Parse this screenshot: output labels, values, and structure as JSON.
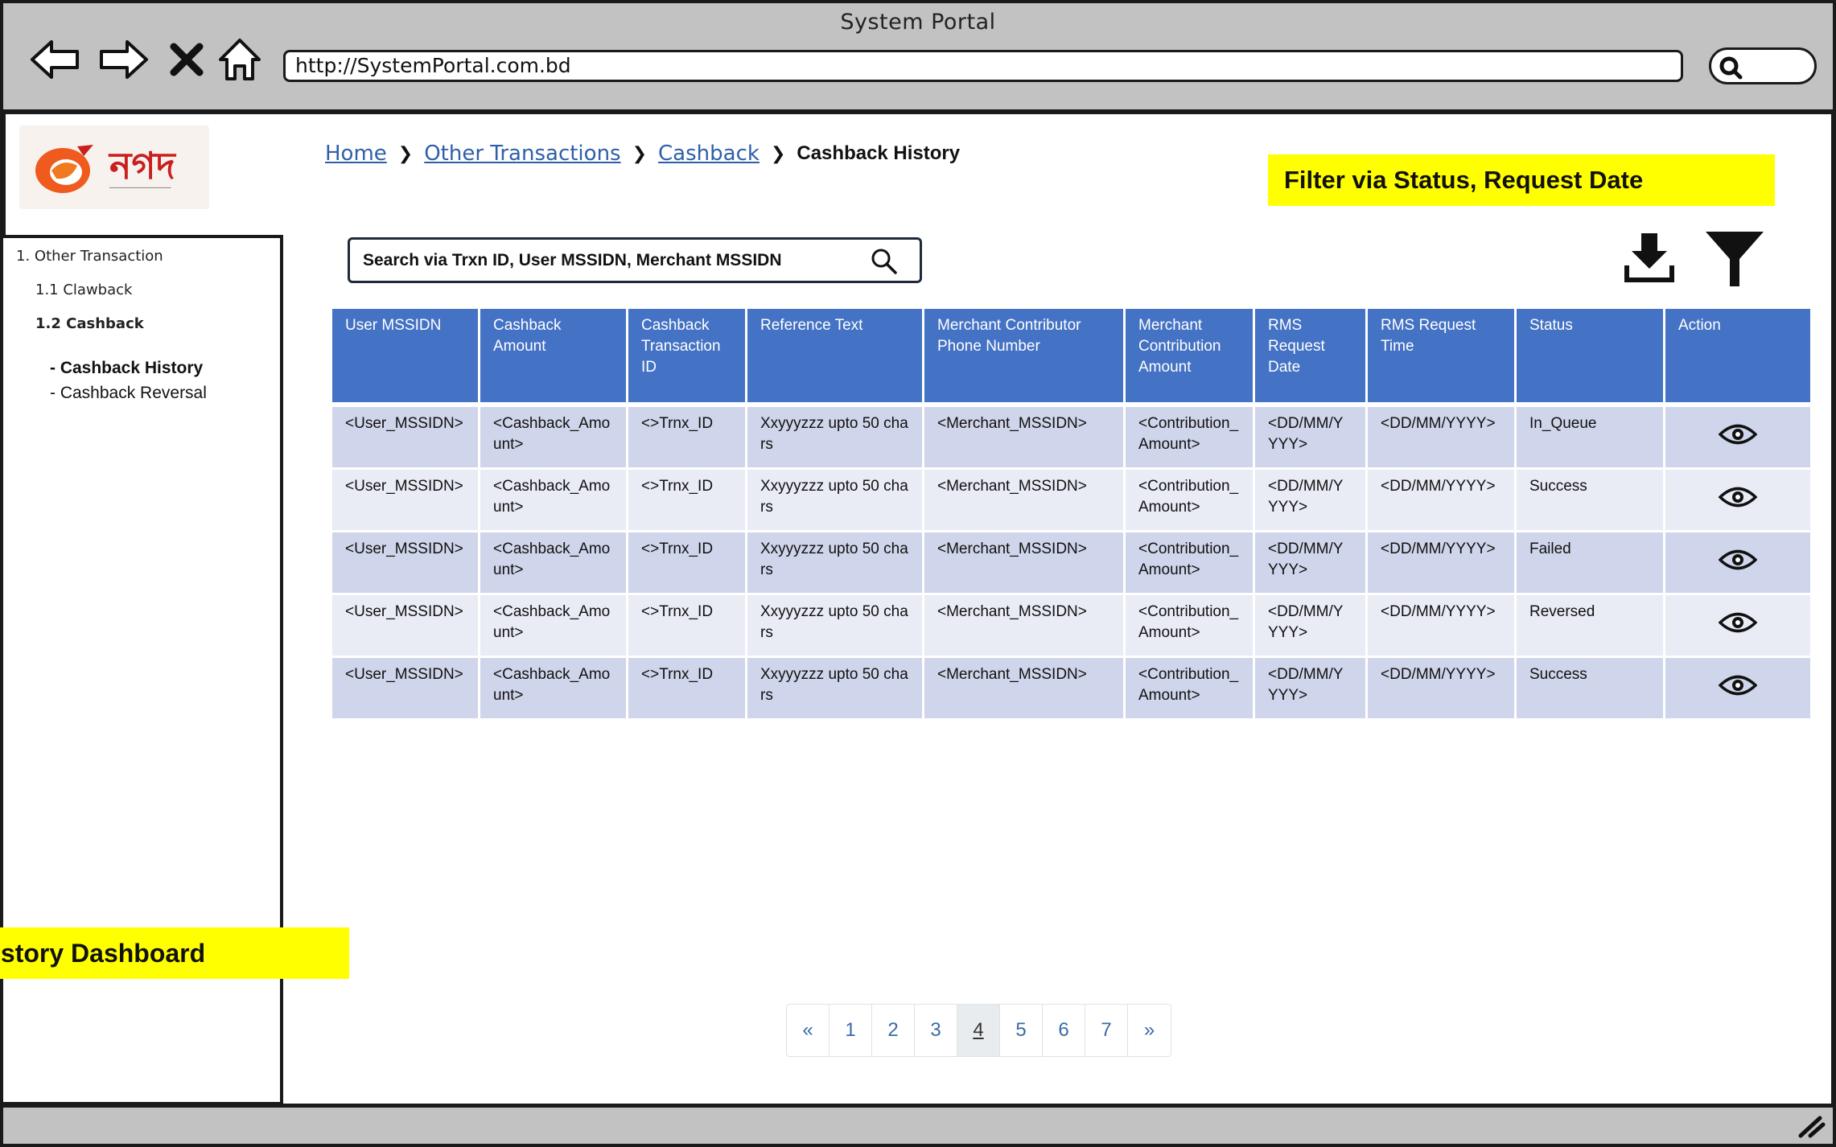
{
  "window": {
    "title": "System Portal"
  },
  "browser": {
    "url": "http://SystemPortal.com.bd",
    "nav_icons": [
      "back-arrow-icon",
      "forward-arrow-icon",
      "close-x-icon",
      "home-icon"
    ]
  },
  "logo": {
    "text": "নগদ"
  },
  "sidebar": {
    "section": "1. Other Transaction",
    "items": [
      {
        "label": "1.1 Clawback"
      },
      {
        "label": "1.2 Cashback"
      }
    ],
    "subitems": [
      {
        "label": "- Cashback History"
      },
      {
        "label": "- Cashback Reversal"
      }
    ]
  },
  "breadcrumb": {
    "items": [
      "Home",
      "Other Transactions",
      "Cashback"
    ],
    "current": "Cashback History"
  },
  "notes": {
    "filter": "Filter via Status, Request Date",
    "dashboard": "istory Dashboard"
  },
  "search": {
    "placeholder": "Search via Trxn ID, User MSSIDN, Merchant MSSIDN"
  },
  "table": {
    "columns": [
      "User MSSIDN",
      "Cashback Amount",
      "Cashback Transaction ID",
      "Reference Text",
      "Merchant Contributor Phone Number",
      "Merchant Contribution Amount",
      "RMS Request Date",
      "RMS Request Time",
      "Status",
      "Action"
    ],
    "rows": [
      {
        "user": "<User_MSSIDN>",
        "amount": "<Cashback_Amount>",
        "trxn": "<>Trnx_ID",
        "ref": "Xxyyyzzz upto 50 chars",
        "merchant": "<Merchant_MSSIDN>",
        "contribution": "<Contribution_Amount>",
        "date": "<DD/MM/YYYY>",
        "time": "<DD/MM/YYYY>",
        "status": "In_Queue"
      },
      {
        "user": "<User_MSSIDN>",
        "amount": "<Cashback_Amount>",
        "trxn": "<>Trnx_ID",
        "ref": "Xxyyyzzz upto 50 chars",
        "merchant": "<Merchant_MSSIDN>",
        "contribution": "<Contribution_Amount>",
        "date": "<DD/MM/YYYY>",
        "time": "<DD/MM/YYYY>",
        "status": "Success"
      },
      {
        "user": "<User_MSSIDN>",
        "amount": "<Cashback_Amount>",
        "trxn": "<>Trnx_ID",
        "ref": "Xxyyyzzz upto 50 chars",
        "merchant": "<Merchant_MSSIDN>",
        "contribution": "<Contribution_Amount>",
        "date": "<DD/MM/YYYY>",
        "time": "<DD/MM/YYYY>",
        "status": "Failed"
      },
      {
        "user": "<User_MSSIDN>",
        "amount": "<Cashback_Amount>",
        "trxn": "<>Trnx_ID",
        "ref": "Xxyyyzzz upto 50 chars",
        "merchant": "<Merchant_MSSIDN>",
        "contribution": "<Contribution_Amount>",
        "date": "<DD/MM/YYYY>",
        "time": "<DD/MM/YYYY>",
        "status": "Reversed"
      },
      {
        "user": "<User_MSSIDN>",
        "amount": "<Cashback_Amount>",
        "trxn": "<>Trnx_ID",
        "ref": "Xxyyyzzz upto 50 chars",
        "merchant": "<Merchant_MSSIDN>",
        "contribution": "<Contribution_Amount>",
        "date": "<DD/MM/YYYY>",
        "time": "<DD/MM/YYYY>",
        "status": "Success"
      }
    ],
    "row_action_icon": "eye-icon"
  },
  "toolbar": {
    "download_icon": "download-icon",
    "filter_icon": "filter-icon"
  },
  "pagination": {
    "prev": "«",
    "pages": [
      "1",
      "2",
      "3",
      "4",
      "5",
      "6",
      "7"
    ],
    "active": "4",
    "next": "»"
  },
  "colors": {
    "header_bg": "#4472c4",
    "row_odd": "#cfd5ea",
    "row_even": "#e9ebf5",
    "note_bg": "#ffff00",
    "chrome": "#c2c2c2",
    "link": "#2f5fa8",
    "brand": "#c8201f"
  }
}
